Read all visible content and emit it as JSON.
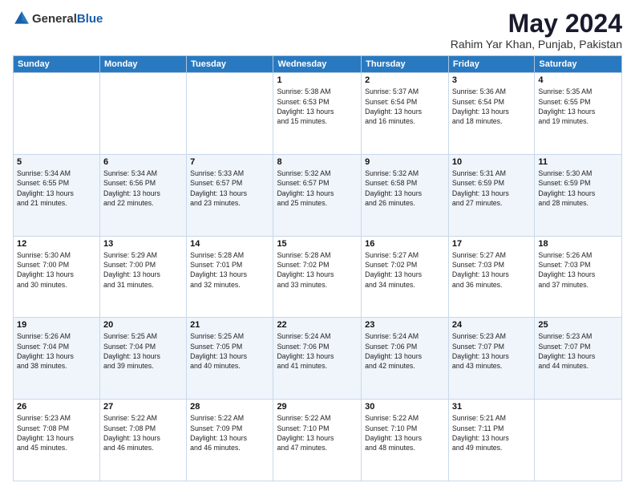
{
  "header": {
    "logo_general": "General",
    "logo_blue": "Blue",
    "month_year": "May 2024",
    "location": "Rahim Yar Khan, Punjab, Pakistan"
  },
  "weekdays": [
    "Sunday",
    "Monday",
    "Tuesday",
    "Wednesday",
    "Thursday",
    "Friday",
    "Saturday"
  ],
  "weeks": [
    [
      {
        "day": "",
        "info": ""
      },
      {
        "day": "",
        "info": ""
      },
      {
        "day": "",
        "info": ""
      },
      {
        "day": "1",
        "info": "Sunrise: 5:38 AM\nSunset: 6:53 PM\nDaylight: 13 hours\nand 15 minutes."
      },
      {
        "day": "2",
        "info": "Sunrise: 5:37 AM\nSunset: 6:54 PM\nDaylight: 13 hours\nand 16 minutes."
      },
      {
        "day": "3",
        "info": "Sunrise: 5:36 AM\nSunset: 6:54 PM\nDaylight: 13 hours\nand 18 minutes."
      },
      {
        "day": "4",
        "info": "Sunrise: 5:35 AM\nSunset: 6:55 PM\nDaylight: 13 hours\nand 19 minutes."
      }
    ],
    [
      {
        "day": "5",
        "info": "Sunrise: 5:34 AM\nSunset: 6:55 PM\nDaylight: 13 hours\nand 21 minutes."
      },
      {
        "day": "6",
        "info": "Sunrise: 5:34 AM\nSunset: 6:56 PM\nDaylight: 13 hours\nand 22 minutes."
      },
      {
        "day": "7",
        "info": "Sunrise: 5:33 AM\nSunset: 6:57 PM\nDaylight: 13 hours\nand 23 minutes."
      },
      {
        "day": "8",
        "info": "Sunrise: 5:32 AM\nSunset: 6:57 PM\nDaylight: 13 hours\nand 25 minutes."
      },
      {
        "day": "9",
        "info": "Sunrise: 5:32 AM\nSunset: 6:58 PM\nDaylight: 13 hours\nand 26 minutes."
      },
      {
        "day": "10",
        "info": "Sunrise: 5:31 AM\nSunset: 6:59 PM\nDaylight: 13 hours\nand 27 minutes."
      },
      {
        "day": "11",
        "info": "Sunrise: 5:30 AM\nSunset: 6:59 PM\nDaylight: 13 hours\nand 28 minutes."
      }
    ],
    [
      {
        "day": "12",
        "info": "Sunrise: 5:30 AM\nSunset: 7:00 PM\nDaylight: 13 hours\nand 30 minutes."
      },
      {
        "day": "13",
        "info": "Sunrise: 5:29 AM\nSunset: 7:00 PM\nDaylight: 13 hours\nand 31 minutes."
      },
      {
        "day": "14",
        "info": "Sunrise: 5:28 AM\nSunset: 7:01 PM\nDaylight: 13 hours\nand 32 minutes."
      },
      {
        "day": "15",
        "info": "Sunrise: 5:28 AM\nSunset: 7:02 PM\nDaylight: 13 hours\nand 33 minutes."
      },
      {
        "day": "16",
        "info": "Sunrise: 5:27 AM\nSunset: 7:02 PM\nDaylight: 13 hours\nand 34 minutes."
      },
      {
        "day": "17",
        "info": "Sunrise: 5:27 AM\nSunset: 7:03 PM\nDaylight: 13 hours\nand 36 minutes."
      },
      {
        "day": "18",
        "info": "Sunrise: 5:26 AM\nSunset: 7:03 PM\nDaylight: 13 hours\nand 37 minutes."
      }
    ],
    [
      {
        "day": "19",
        "info": "Sunrise: 5:26 AM\nSunset: 7:04 PM\nDaylight: 13 hours\nand 38 minutes."
      },
      {
        "day": "20",
        "info": "Sunrise: 5:25 AM\nSunset: 7:04 PM\nDaylight: 13 hours\nand 39 minutes."
      },
      {
        "day": "21",
        "info": "Sunrise: 5:25 AM\nSunset: 7:05 PM\nDaylight: 13 hours\nand 40 minutes."
      },
      {
        "day": "22",
        "info": "Sunrise: 5:24 AM\nSunset: 7:06 PM\nDaylight: 13 hours\nand 41 minutes."
      },
      {
        "day": "23",
        "info": "Sunrise: 5:24 AM\nSunset: 7:06 PM\nDaylight: 13 hours\nand 42 minutes."
      },
      {
        "day": "24",
        "info": "Sunrise: 5:23 AM\nSunset: 7:07 PM\nDaylight: 13 hours\nand 43 minutes."
      },
      {
        "day": "25",
        "info": "Sunrise: 5:23 AM\nSunset: 7:07 PM\nDaylight: 13 hours\nand 44 minutes."
      }
    ],
    [
      {
        "day": "26",
        "info": "Sunrise: 5:23 AM\nSunset: 7:08 PM\nDaylight: 13 hours\nand 45 minutes."
      },
      {
        "day": "27",
        "info": "Sunrise: 5:22 AM\nSunset: 7:08 PM\nDaylight: 13 hours\nand 46 minutes."
      },
      {
        "day": "28",
        "info": "Sunrise: 5:22 AM\nSunset: 7:09 PM\nDaylight: 13 hours\nand 46 minutes."
      },
      {
        "day": "29",
        "info": "Sunrise: 5:22 AM\nSunset: 7:10 PM\nDaylight: 13 hours\nand 47 minutes."
      },
      {
        "day": "30",
        "info": "Sunrise: 5:22 AM\nSunset: 7:10 PM\nDaylight: 13 hours\nand 48 minutes."
      },
      {
        "day": "31",
        "info": "Sunrise: 5:21 AM\nSunset: 7:11 PM\nDaylight: 13 hours\nand 49 minutes."
      },
      {
        "day": "",
        "info": ""
      }
    ]
  ]
}
